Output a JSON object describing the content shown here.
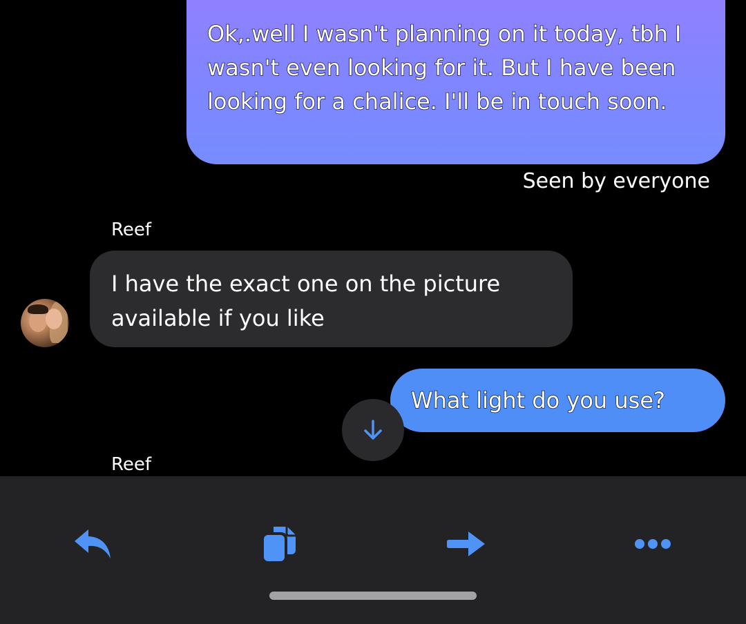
{
  "messages": {
    "outgoing_1": "Ok,.well I wasn't planning on it today, tbh I wasn't even looking for it. But I have been looking for a chalice. I'll be in touch soon.",
    "seen_status": "Seen by everyone",
    "sender_1": "Reef",
    "incoming_1": "I have the exact one on the picture available if you like",
    "outgoing_2": "What light do you use?",
    "sender_2": "Reef"
  },
  "toolbar": {
    "icons": [
      "reply-icon",
      "copy-icon",
      "forward-icon",
      "more-icon"
    ]
  },
  "colors": {
    "background": "#000000",
    "outgoing_bubble_gradient_start": "#8f80ff",
    "outgoing_bubble_gradient_end": "#768cff",
    "outgoing_bubble_solid": "#4f8ef7",
    "incoming_bubble": "#2c2c2e",
    "toolbar_background": "#232325",
    "icon_blue": "#4f93f6"
  }
}
